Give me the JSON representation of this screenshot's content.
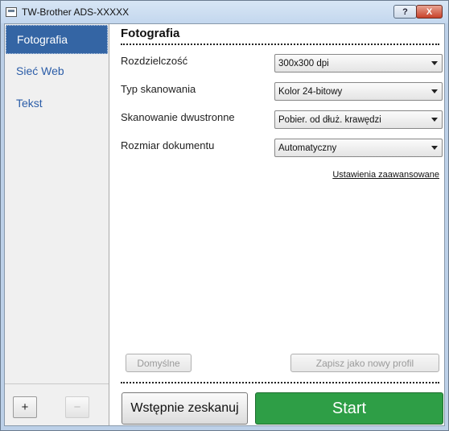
{
  "window": {
    "title": "TW-Brother ADS-XXXXX",
    "help_label": "?",
    "close_label": "X"
  },
  "sidebar": {
    "items": [
      {
        "label": "Fotografia",
        "active": true
      },
      {
        "label": "Sieć Web",
        "active": false
      },
      {
        "label": "Tekst",
        "active": false
      }
    ],
    "add_label": "+",
    "remove_label": "−"
  },
  "main": {
    "title": "Fotografia",
    "settings": [
      {
        "label": "Rozdzielczość",
        "value": "300x300 dpi"
      },
      {
        "label": "Typ skanowania",
        "value": "Kolor 24-bitowy"
      },
      {
        "label": "Skanowanie dwustronne",
        "value": "Pobier. od dłuż. krawędzi"
      },
      {
        "label": "Rozmiar dokumentu",
        "value": "Automatyczny"
      }
    ],
    "advanced_link": "Ustawienia zaawansowane",
    "default_button": "Domyślne",
    "save_profile_button": "Zapisz jako nowy profil",
    "prescan_button": "Wstępnie zeskanuj",
    "start_button": "Start"
  },
  "colors": {
    "accent": "#3465a4",
    "start": "#2e9e46",
    "titlebar": "#c3d7ee"
  }
}
